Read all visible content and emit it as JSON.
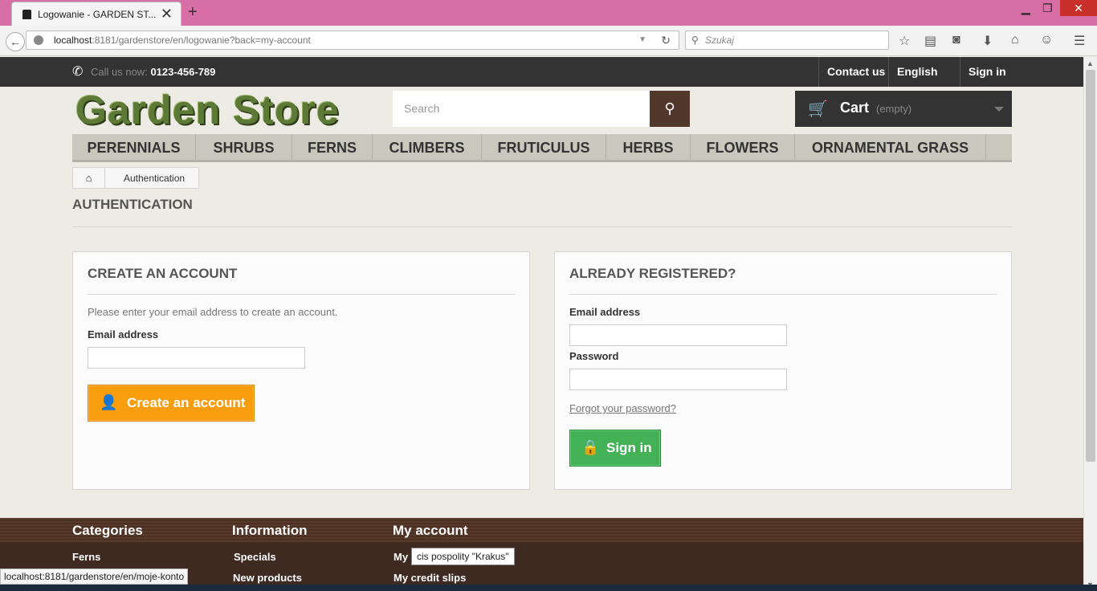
{
  "browser": {
    "tab_title": "Logowanie - GARDEN ST...",
    "url_host": "localhost",
    "url_rest": ":8181/gardenstore/en/logowanie?back=my-account",
    "search_placeholder": "Szukaj",
    "status_url": "localhost:8181/gardenstore/en/moje-konto"
  },
  "topbar": {
    "call_label": "Call us now:",
    "phone": "0123-456-789",
    "contact": "Contact us",
    "language": "English",
    "signin": "Sign in"
  },
  "header": {
    "logo": "Garden Store",
    "search_placeholder": "Search",
    "cart_label": "Cart",
    "cart_status": "(empty)"
  },
  "menu": [
    "PERENNIALS",
    "SHRUBS",
    "FERNS",
    "CLIMBERS",
    "FRUTICULUS",
    "HERBS",
    "FLOWERS",
    "ORNAMENTAL GRASS"
  ],
  "breadcrumb": {
    "current": "Authentication"
  },
  "page_title": "AUTHENTICATION",
  "create": {
    "title": "CREATE AN ACCOUNT",
    "intro": "Please enter your email address to create an account.",
    "email_label": "Email address",
    "button": "Create an account"
  },
  "login": {
    "title": "ALREADY REGISTERED?",
    "email_label": "Email address",
    "password_label": "Password",
    "forgot": "Forgot your password?",
    "button": "Sign in"
  },
  "footer": {
    "categories": {
      "title": "Categories",
      "items": [
        "Ferns"
      ]
    },
    "information": {
      "title": "Information",
      "items": [
        "Specials",
        "New products"
      ]
    },
    "account": {
      "title": "My account",
      "items": [
        "My",
        "My credit slips"
      ]
    },
    "tooltip": "cis pospolity \"Krakus\""
  }
}
